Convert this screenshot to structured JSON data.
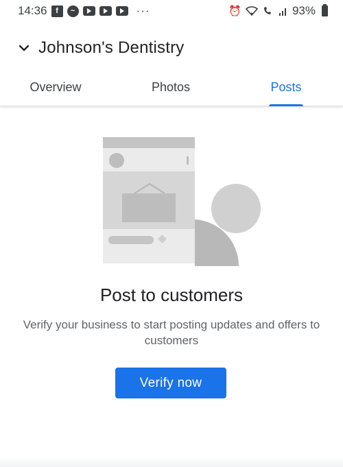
{
  "status_bar": {
    "time": "14:36",
    "notification_icons": [
      "facebook-icon",
      "messenger-icon",
      "youtube-icon",
      "youtube-icon",
      "youtube-icon"
    ],
    "more": "···",
    "system_icons": [
      "alarm-icon",
      "wifi-icon",
      "volte-signal-icon",
      "signal-bars-icon"
    ],
    "battery": "93%"
  },
  "header": {
    "title": "Johnson's Dentistry",
    "collapse_icon": "chevron-down-icon"
  },
  "tabs": [
    {
      "label": "Overview",
      "active": false
    },
    {
      "label": "Photos",
      "active": false
    },
    {
      "label": "Posts",
      "active": true
    }
  ],
  "empty_state": {
    "illustration": "post-illustration",
    "heading": "Post to customers",
    "description": "Verify your business to start posting updates and offers to customers",
    "button_label": "Verify now"
  },
  "colors": {
    "accent": "#1a73e8",
    "text_primary": "#202124",
    "text_secondary": "#5f6368",
    "illustration_gray": "#bdbdbd"
  }
}
